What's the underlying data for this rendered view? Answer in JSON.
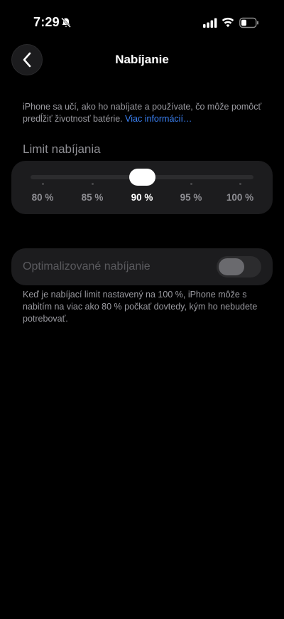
{
  "status_bar": {
    "time": "7:29",
    "bell_icon": "bell-slash-icon",
    "signal_icon": "cellular-signal-icon",
    "wifi_icon": "wifi-icon",
    "battery_icon": "battery-low-icon"
  },
  "nav": {
    "back_icon": "chevron-left-icon",
    "title": "Nabíjanie"
  },
  "description": {
    "text": "iPhone sa učí, ako ho nabíjate a používate, čo môže pomôcť predĺžiť životnosť batérie. ",
    "link": "Viac informácií…"
  },
  "charge_limit": {
    "header": "Limit nabíjania",
    "options": [
      "80 %",
      "85 %",
      "90 %",
      "95 %",
      "100 %"
    ],
    "selected": "90 %",
    "selected_index": 2
  },
  "optimized_charging": {
    "label": "Optimalizované nabíjanie",
    "enabled": false,
    "disabled_appearance": true,
    "footer": "Keď je nabíjací limit nastavený na 100 %, iPhone môže s nabitím na viac ako 80 % počkať dovtedy, kým ho nebudete potrebovať."
  },
  "colors": {
    "background": "#000000",
    "card": "#1c1c1e",
    "link": "#3b82f6",
    "secondary_text": "#8e8e93"
  }
}
